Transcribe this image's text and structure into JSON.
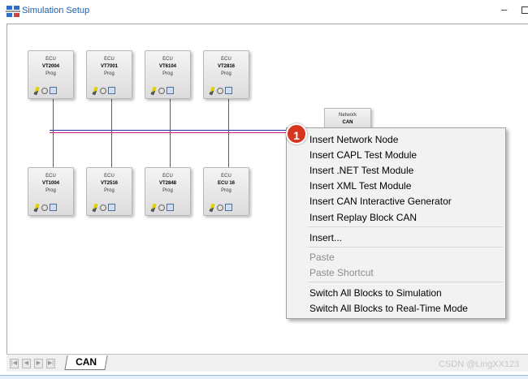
{
  "window": {
    "title": "Simulation Setup",
    "minimize_glyph": "–"
  },
  "ecus_top": [
    {
      "type": "ECU",
      "name": "VT2004",
      "mode": "Prog"
    },
    {
      "type": "ECU",
      "name": "VT7001",
      "mode": "Prog"
    },
    {
      "type": "ECU",
      "name": "VT6104",
      "mode": "Prog"
    },
    {
      "type": "ECU",
      "name": "VT2816",
      "mode": "Prog"
    }
  ],
  "ecus_bottom": [
    {
      "type": "ECU",
      "name": "VT1004",
      "mode": "Prog"
    },
    {
      "type": "ECU",
      "name": "VT2516",
      "mode": "Prog"
    },
    {
      "type": "ECU",
      "name": "VT2848",
      "mode": "Prog"
    },
    {
      "type": "ECU",
      "name": "ECU 16",
      "mode": "Prog"
    }
  ],
  "network": {
    "type": "Network",
    "name": "CAN"
  },
  "bus_colors": {
    "primary": "#1f2f9a",
    "secondary": "#d02060"
  },
  "badge": {
    "number": "1",
    "color": "#d8351f"
  },
  "context_menu": {
    "items": [
      {
        "label": "Insert Network Node",
        "enabled": true
      },
      {
        "label": "Insert CAPL Test Module",
        "enabled": true
      },
      {
        "label": "Insert .NET Test Module",
        "enabled": true
      },
      {
        "label": "Insert XML Test Module",
        "enabled": true
      },
      {
        "label": "Insert CAN Interactive Generator",
        "enabled": true
      },
      {
        "label": "Insert Replay Block CAN",
        "enabled": true
      },
      {
        "label": "Insert...",
        "enabled": true
      },
      {
        "label": "Paste",
        "enabled": false
      },
      {
        "label": "Paste Shortcut",
        "enabled": false
      },
      {
        "label": "Switch All Blocks to Simulation",
        "enabled": true
      },
      {
        "label": "Switch All Blocks to Real-Time Mode",
        "enabled": true
      }
    ]
  },
  "tabs": {
    "nav_glyphs": [
      "|◀",
      "◀",
      "▶",
      "▶|"
    ],
    "active_tab": "CAN"
  },
  "watermark": "CSDN @LingXX123"
}
